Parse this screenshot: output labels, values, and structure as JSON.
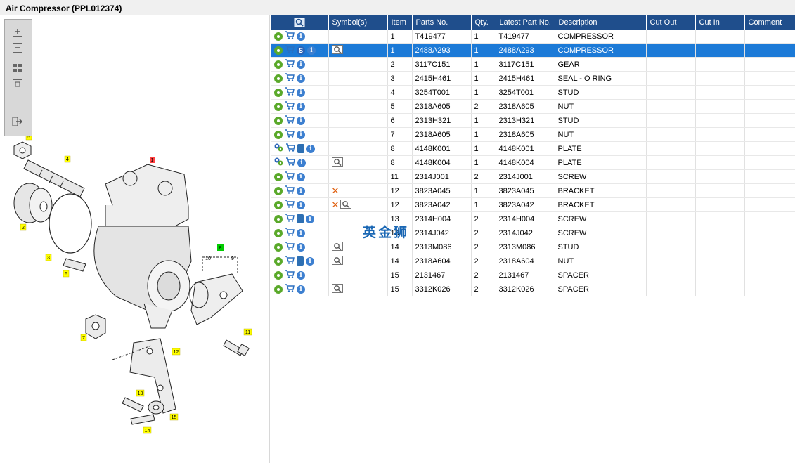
{
  "title": "Air Compressor (PPL012374)",
  "watermark": "英金狮",
  "colors": {
    "header": "#1f4e8c",
    "selected_row": "#1c7ad7",
    "callout_yellow": "#ffff00",
    "callout_red": "#ff4040",
    "callout_green": "#00cc00"
  },
  "zoom_toolbar": {
    "zoom_in": "zoom-in-icon",
    "zoom_out": "zoom-out-icon",
    "fit_all": "fit-all-icon",
    "fit_window": "fit-window-icon",
    "export": "export-icon"
  },
  "diagram": {
    "callouts": [
      "1",
      "2",
      "3",
      "4",
      "5",
      "6",
      "7",
      "8",
      "9",
      "10",
      "11",
      "12",
      "13",
      "14",
      "15"
    ]
  },
  "columns": [
    "",
    "Symbol(s)",
    "Item",
    "Parts No.",
    "Qty.",
    "Latest Part No.",
    "Description",
    "Cut Out",
    "Cut In",
    "Comment"
  ],
  "rows": [
    {
      "item": "1",
      "part": "T419477",
      "qty": "1",
      "latest": "T419477",
      "desc": "COMPRESSOR",
      "cut_out": "",
      "cut_in": "",
      "comment": "",
      "selected": false,
      "icons": [
        "gear",
        "cart",
        "info"
      ],
      "symbols": []
    },
    {
      "item": "1",
      "part": "2488A293",
      "qty": "1",
      "latest": "2488A293",
      "desc": "COMPRESSOR",
      "cut_out": "",
      "cut_in": "",
      "comment": "",
      "selected": true,
      "icons": [
        "gear",
        "cart",
        "s",
        "info"
      ],
      "symbols": [
        "view"
      ]
    },
    {
      "item": "2",
      "part": "3117C151",
      "qty": "1",
      "latest": "3117C151",
      "desc": "GEAR",
      "cut_out": "",
      "cut_in": "",
      "comment": "",
      "selected": false,
      "icons": [
        "gear",
        "cart",
        "info"
      ],
      "symbols": []
    },
    {
      "item": "3",
      "part": "2415H461",
      "qty": "1",
      "latest": "2415H461",
      "desc": "SEAL - O RING",
      "cut_out": "",
      "cut_in": "",
      "comment": "",
      "selected": false,
      "icons": [
        "gear",
        "cart",
        "info"
      ],
      "symbols": []
    },
    {
      "item": "4",
      "part": "3254T001",
      "qty": "1",
      "latest": "3254T001",
      "desc": "STUD",
      "cut_out": "",
      "cut_in": "",
      "comment": "",
      "selected": false,
      "icons": [
        "gear",
        "cart",
        "info"
      ],
      "symbols": []
    },
    {
      "item": "5",
      "part": "2318A605",
      "qty": "2",
      "latest": "2318A605",
      "desc": "NUT",
      "cut_out": "",
      "cut_in": "",
      "comment": "",
      "selected": false,
      "icons": [
        "gear",
        "cart",
        "info"
      ],
      "symbols": []
    },
    {
      "item": "6",
      "part": "2313H321",
      "qty": "1",
      "latest": "2313H321",
      "desc": "STUD",
      "cut_out": "",
      "cut_in": "",
      "comment": "",
      "selected": false,
      "icons": [
        "gear",
        "cart",
        "info"
      ],
      "symbols": []
    },
    {
      "item": "7",
      "part": "2318A605",
      "qty": "1",
      "latest": "2318A605",
      "desc": "NUT",
      "cut_out": "",
      "cut_in": "",
      "comment": "",
      "selected": false,
      "icons": [
        "gear",
        "cart",
        "info"
      ],
      "symbols": []
    },
    {
      "item": "8",
      "part": "4148K001",
      "qty": "1",
      "latest": "4148K001",
      "desc": "PLATE",
      "cut_out": "",
      "cut_in": "",
      "comment": "",
      "selected": false,
      "icons": [
        "gearblue",
        "cart",
        "doc",
        "info"
      ],
      "symbols": []
    },
    {
      "item": "8",
      "part": "4148K004",
      "qty": "1",
      "latest": "4148K004",
      "desc": "PLATE",
      "cut_out": "",
      "cut_in": "",
      "comment": "",
      "selected": false,
      "icons": [
        "gearblue",
        "cart",
        "info"
      ],
      "symbols": [
        "view"
      ]
    },
    {
      "item": "11",
      "part": "2314J001",
      "qty": "2",
      "latest": "2314J001",
      "desc": "SCREW",
      "cut_out": "",
      "cut_in": "",
      "comment": "",
      "selected": false,
      "icons": [
        "gear",
        "cart",
        "info"
      ],
      "symbols": []
    },
    {
      "item": "12",
      "part": "3823A045",
      "qty": "1",
      "latest": "3823A045",
      "desc": "BRACKET",
      "cut_out": "",
      "cut_in": "",
      "comment": "",
      "selected": false,
      "icons": [
        "gear",
        "cart",
        "info"
      ],
      "symbols": [
        "x"
      ]
    },
    {
      "item": "12",
      "part": "3823A042",
      "qty": "1",
      "latest": "3823A042",
      "desc": "BRACKET",
      "cut_out": "",
      "cut_in": "",
      "comment": "",
      "selected": false,
      "icons": [
        "gear",
        "cart",
        "info"
      ],
      "symbols": [
        "x",
        "view"
      ]
    },
    {
      "item": "13",
      "part": "2314H004",
      "qty": "2",
      "latest": "2314H004",
      "desc": "SCREW",
      "cut_out": "",
      "cut_in": "",
      "comment": "",
      "selected": false,
      "icons": [
        "gear",
        "cart",
        "doc",
        "info"
      ],
      "symbols": []
    },
    {
      "item": "13",
      "part": "2314J042",
      "qty": "2",
      "latest": "2314J042",
      "desc": "SCREW",
      "cut_out": "",
      "cut_in": "",
      "comment": "",
      "selected": false,
      "icons": [
        "gear",
        "cart",
        "info"
      ],
      "symbols": []
    },
    {
      "item": "14",
      "part": "2313M086",
      "qty": "2",
      "latest": "2313M086",
      "desc": "STUD",
      "cut_out": "",
      "cut_in": "",
      "comment": "",
      "selected": false,
      "icons": [
        "gear",
        "cart",
        "info"
      ],
      "symbols": [
        "view"
      ]
    },
    {
      "item": "14",
      "part": "2318A604",
      "qty": "2",
      "latest": "2318A604",
      "desc": "NUT",
      "cut_out": "",
      "cut_in": "",
      "comment": "",
      "selected": false,
      "icons": [
        "gear",
        "cart",
        "doc",
        "info"
      ],
      "symbols": [
        "view"
      ]
    },
    {
      "item": "15",
      "part": "2131467",
      "qty": "2",
      "latest": "2131467",
      "desc": "SPACER",
      "cut_out": "",
      "cut_in": "",
      "comment": "",
      "selected": false,
      "icons": [
        "gear",
        "cart",
        "info"
      ],
      "symbols": []
    },
    {
      "item": "15",
      "part": "3312K026",
      "qty": "2",
      "latest": "3312K026",
      "desc": "SPACER",
      "cut_out": "",
      "cut_in": "",
      "comment": "",
      "selected": false,
      "icons": [
        "gear",
        "cart",
        "info"
      ],
      "symbols": [
        "view"
      ]
    }
  ]
}
